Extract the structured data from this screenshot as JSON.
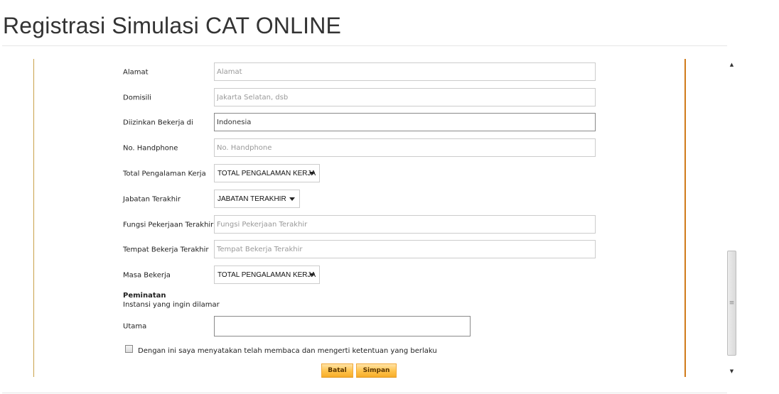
{
  "page": {
    "title": "Registrasi Simulasi CAT ONLINE"
  },
  "form": {
    "alamat": {
      "label": "Alamat",
      "value": "",
      "placeholder": "Alamat"
    },
    "domisili": {
      "label": "Domisili",
      "value": "",
      "placeholder": "Jakarta Selatan, dsb"
    },
    "diizinkan": {
      "label": "Diizinkan Bekerja di",
      "value": "Indonesia",
      "placeholder": ""
    },
    "handphone": {
      "label": "No. Handphone",
      "value": "",
      "placeholder": "No. Handphone"
    },
    "total_pengalaman": {
      "label": "Total Pengalaman Kerja",
      "selected": "TOTAL PENGALAMAN KERJA"
    },
    "jabatan": {
      "label": "Jabatan Terakhir",
      "selected": "JABATAN TERAKHIR"
    },
    "fungsi": {
      "label": "Fungsi Pekerjaan Terakhir",
      "value": "",
      "placeholder": "Fungsi Pekerjaan Terakhir"
    },
    "tempat": {
      "label": "Tempat Bekerja Terakhir",
      "value": "",
      "placeholder": "Tempat Bekerja Terakhir"
    },
    "masa": {
      "label": "Masa Bekerja",
      "selected": "TOTAL PENGALAMAN KERJA"
    },
    "peminatan": {
      "title": "Peminatan",
      "subtitle": "Instansi yang ingin dilamar",
      "utama": {
        "label": "Utama",
        "value": ""
      }
    },
    "agreement": {
      "label": "Dengan ini saya menyatakan telah membaca dan mengerti ketentuan yang berlaku",
      "checked": false
    },
    "buttons": {
      "cancel": "Batal",
      "save": "Simpan"
    }
  },
  "scrollbar": {
    "up_icon": "▲",
    "down_icon": "▼",
    "grip_icon": "≡"
  },
  "colors": {
    "frame_left": "#c9a24a",
    "frame_right": "#d07a1a",
    "button_accent": "#ffc24a"
  }
}
